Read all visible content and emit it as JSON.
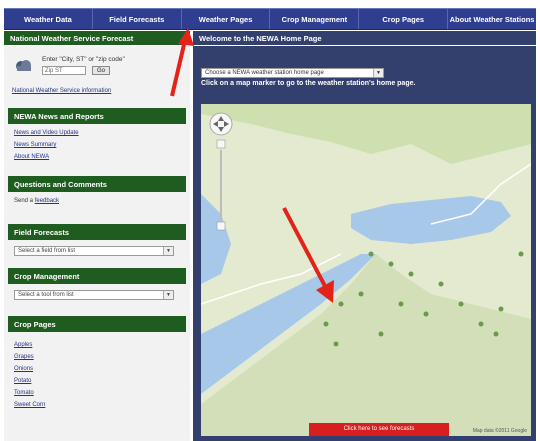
{
  "nav": {
    "items": [
      "Weather Data",
      "Field Forecasts",
      "Weather Pages",
      "Crop Management",
      "Crop Pages",
      "About Weather Stations"
    ]
  },
  "left_header": "National Weather Service Forecast",
  "right_header": "Welcome to the NEWA Home Page",
  "weather_widget": {
    "label": "Enter \"City, ST\" or \"zip code\"",
    "input_value": "Zip ST",
    "go": "Go",
    "link": "National Weather Service information"
  },
  "sections": {
    "news": {
      "title": "NEWA News and Reports",
      "links": [
        "News and Video Update",
        "News Summary",
        "About NEWA"
      ]
    },
    "questions": {
      "title": "Questions and Comments",
      "text": "Send a ",
      "link": "feedback"
    },
    "field": {
      "title": "Field Forecasts",
      "select": "Select a field from list"
    },
    "crop_mgmt": {
      "title": "Crop Management",
      "select": "Select a tool from list"
    },
    "crop_pages": {
      "title": "Crop Pages",
      "links": [
        "Apples",
        "Grapes",
        "Onions",
        "Potato",
        "Tomato",
        "Sweet Corn"
      ]
    }
  },
  "main": {
    "select": "Choose a NEWA weather station home page",
    "instruction": "Click on a map marker to go to the weather station's home page.",
    "map_button": "Click here to see forecasts",
    "map_footer": "Map data ©2011 Google"
  },
  "colors": {
    "nav": "#2f3e8f",
    "green_header": "#1f5c1f",
    "main_bg": "#33406d",
    "arrow": "#e2231a"
  }
}
